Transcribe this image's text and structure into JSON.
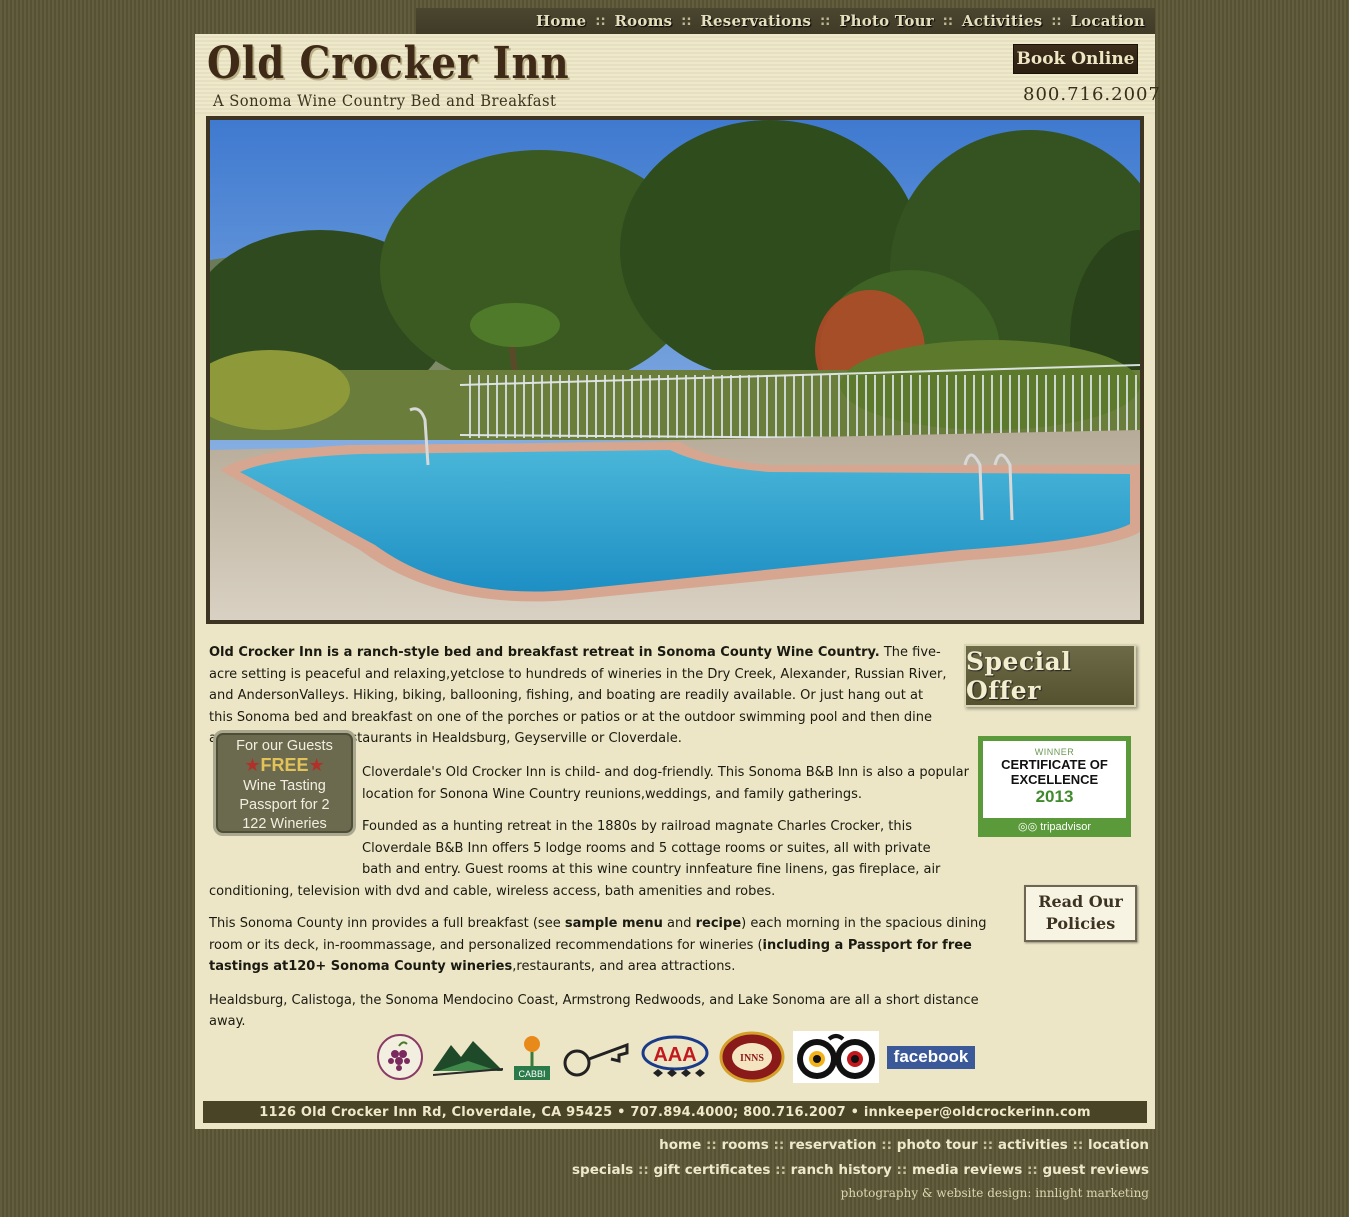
{
  "nav": {
    "items": [
      "Home",
      "Rooms",
      "Reservations",
      "Photo Tour",
      "Activities",
      "Location"
    ],
    "separator": "::"
  },
  "header": {
    "title": "Old Crocker Inn",
    "tagline": "A Sonoma Wine Country Bed and Breakfast",
    "book_label": "Book Online",
    "phone": "800.716.2007"
  },
  "hero": {
    "icon": "pool-photo"
  },
  "sidebar": {
    "special_offer": "Special Offer",
    "tripadvisor": {
      "winner": "WINNER",
      "cert_line1": "CERTIFICATE OF",
      "cert_line2": "EXCELLENCE",
      "year": "2013",
      "brand": "tripadvisor"
    },
    "policies_line1": "Read Our",
    "policies_line2": "Policies"
  },
  "badge": {
    "line1": "For our Guests",
    "free": "FREE",
    "line2": "Wine Tasting",
    "line3": "Passport for 2",
    "line4": "122 Wineries"
  },
  "content": {
    "p1_bold": "Old Crocker Inn is a ranch-style bed and breakfast retreat in Sonoma County Wine Country.",
    "p1_rest": " The five-acre setting is peaceful and relaxing,yetclose to hundreds of wineries in the Dry Creek, Alexander, Russian River, and AndersonValleys.  Hiking, biking, ballooning, fishing, and boating are readily available.  Or just hang out at this Sonoma bed and breakfast on one of the porches or patios or at the outdoor swimming pool and then dine at one of the many restaurants in Healdsburg, Geyserville or Cloverdale.",
    "p2": "Cloverdale's Old Crocker Inn is child- and dog-friendly. This Sonoma B&B Inn is also a popular location for Sonona Wine Country reunions,weddings, and family gatherings.",
    "p3": "Founded as a hunting retreat in the 1880s by railroad magnate Charles Crocker, this Cloverdale B&B Inn offers 5 lodge rooms and 5 cottage rooms or suites, all with private bath and entry. Guest rooms at this wine country innfeature fine linens, gas fireplace, air conditioning, television with dvd and cable, wireless access, bath amenities and robes.",
    "p4_a": "This Sonoma County inn provides a full breakfast (see ",
    "p4_menu": "sample menu",
    "p4_b": " and ",
    "p4_recipe": "recipe",
    "p4_c": ") each morning in the spacious dining room or its deck, in-roommassage, and personalized recommendations for wineries (",
    "p4_bold": "including a Passport for free tastings at120+ Sonoma County wineries",
    "p4_d": ",restaurants, and area attractions.",
    "p5": "Healdsburg, Calistoga, the Sonoma Mendocino Coast, Armstrong Redwoods, and Lake Sonoma are all a short distance away."
  },
  "logos": {
    "rrwr": "RUSSIAN RIVER WINE ROAD",
    "cabbi": "CABBI",
    "aaa": "AAA",
    "wine_country_inns": "WINE COUNTRY INNS",
    "facebook": "facebook"
  },
  "address": "1126 Old Crocker Inn Rd, Cloverdale, CA 95425  •  707.894.4000; 800.716.2007  •  innkeeper@oldcrockerinn.com",
  "footer": {
    "row1": [
      "home",
      "rooms",
      "reservation",
      "photo tour",
      "activities",
      "location"
    ],
    "row2": [
      "specials",
      "gift certificates",
      "ranch history",
      "media reviews",
      "guest reviews"
    ],
    "credit": "photography & website design: innlight marketing"
  },
  "colors": {
    "background": "#5e5939",
    "panel": "#ece6c7",
    "address_bar": "#4a4426",
    "facebook": "#3b5998",
    "tripadvisor": "#5a9a3a"
  }
}
